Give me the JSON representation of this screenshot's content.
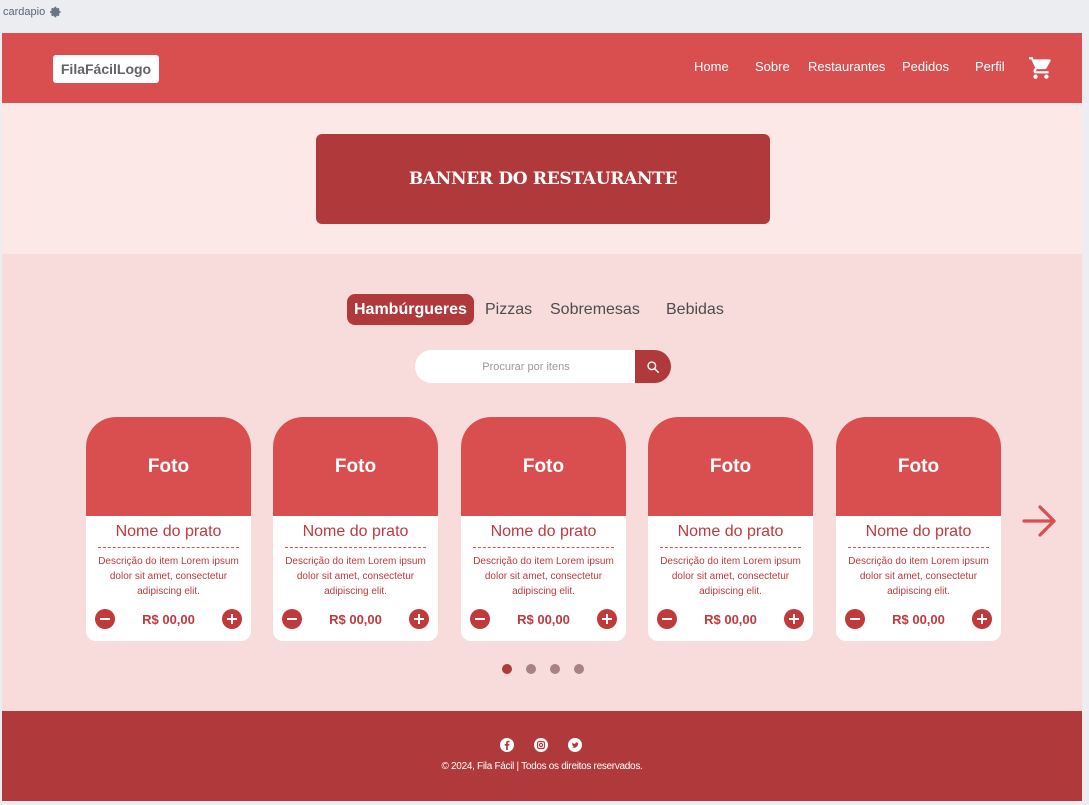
{
  "frame": {
    "label": "cardapio",
    "icon": "gear-icon"
  },
  "header": {
    "logo": "FilaFácilLogo",
    "nav": [
      "Home",
      "Sobre",
      "Restaurantes",
      "Pedidos",
      "Perfil"
    ],
    "cart_icon": "shopping-cart-icon"
  },
  "banner": {
    "title": "BANNER DO RESTAURANTE"
  },
  "tabs": [
    "Hambúrgueres",
    "Pizzas",
    "Sobremesas",
    "Bebidas"
  ],
  "active_tab": "Hambúrgueres",
  "search": {
    "placeholder": "Procurar por itens",
    "value": "",
    "icon": "search-icon"
  },
  "cards": [
    {
      "photo": "Foto",
      "name": "Nome do prato",
      "description": "Descrição do item Lorem ipsum dolor sit amet, consectetur adipiscing elit.",
      "price": "R$ 00,00"
    },
    {
      "photo": "Foto",
      "name": "Nome do prato",
      "description": "Descrição do item Lorem ipsum dolor sit amet, consectetur adipiscing elit.",
      "price": "R$ 00,00"
    },
    {
      "photo": "Foto",
      "name": "Nome do prato",
      "description": "Descrição do item Lorem ipsum dolor sit amet, consectetur adipiscing elit.",
      "price": "R$ 00,00"
    },
    {
      "photo": "Foto",
      "name": "Nome do prato",
      "description": "Descrição do item Lorem ipsum dolor sit amet, consectetur adipiscing elit.",
      "price": "R$ 00,00"
    },
    {
      "photo": "Foto",
      "name": "Nome do prato",
      "description": "Descrição do item Lorem ipsum dolor sit amet, consectetur adipiscing elit.",
      "price": "R$ 00,00"
    }
  ],
  "carousel": {
    "pages": 4,
    "active_page": 1,
    "next_icon": "arrow-right-icon"
  },
  "footer": {
    "social_icons": [
      "facebook-icon",
      "instagram-icon",
      "twitter-icon"
    ],
    "copyright": "© 2024, Fila Fácil | Todos os direitos reservados."
  },
  "colors": {
    "primary": "#d94f50",
    "dark": "#b03a3b",
    "background": "#f8dcdc",
    "banner_bg": "#fce8e7"
  }
}
